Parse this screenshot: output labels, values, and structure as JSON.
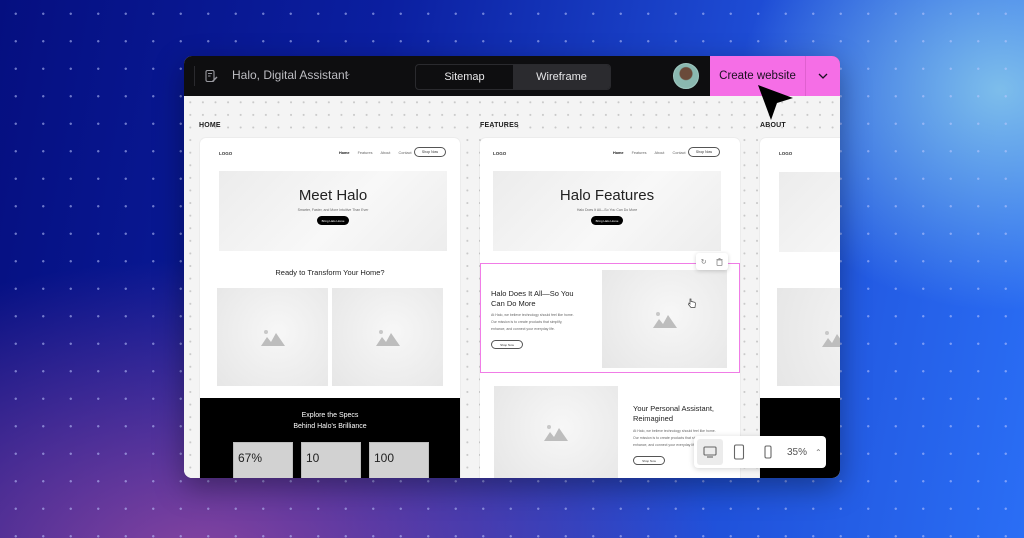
{
  "topbar": {
    "project_name": "Halo, Digital Assistant",
    "view_tabs": [
      {
        "label": "Sitemap",
        "active": false
      },
      {
        "label": "Wireframe",
        "active": true
      }
    ],
    "create_button": "Create website",
    "accent_color": "#f56ee6"
  },
  "pages": [
    {
      "label": "HOME",
      "logo": "LOGO",
      "nav": [
        "Home",
        "Features",
        "About",
        "Contact"
      ],
      "shop_button": "Shop Now",
      "hero_title": "Meet Halo",
      "hero_subtitle": "Smarter, Faster, and More Intuitive Than Ever",
      "hero_button": "Bring Halo Home",
      "section_title": "Ready to Transform Your Home?",
      "specs_title_line1": "Explore the Specs",
      "specs_title_line2": "Behind Halo's Brilliance",
      "stats": [
        "67%",
        "10",
        "100"
      ]
    },
    {
      "label": "FEATURES",
      "logo": "LOGO",
      "nav": [
        "Home",
        "Features",
        "About",
        "Contact"
      ],
      "shop_button": "Shop Now",
      "hero_title": "Halo Features",
      "hero_subtitle": "Halo Does It All—So You Can Do More",
      "hero_button": "Bring Halo Home",
      "section1_heading_line1": "Halo Does It All—So You",
      "section1_heading_line2": "Can Do More",
      "section1_body": [
        "At Halo, we believe technology should feel like home.",
        "Our mission is to create products that simplify,",
        "enhance, and connect your everyday life."
      ],
      "section1_button": "Shop Now",
      "section2_heading_line1": "Your Personal Assistant,",
      "section2_heading_line2": "Reimagined",
      "section2_body": [
        "At Halo, we believe technology should feel like home.",
        "Our mission is to create products that simplify,",
        "enhance, and connect your everyday life."
      ],
      "section2_button": "Shop Now"
    },
    {
      "label": "ABOUT",
      "logo": "LOGO"
    }
  ],
  "zoom_bar": {
    "devices": [
      "desktop-icon",
      "tablet-icon",
      "mobile-icon"
    ],
    "active_device": "desktop",
    "zoom_level": "35%"
  }
}
